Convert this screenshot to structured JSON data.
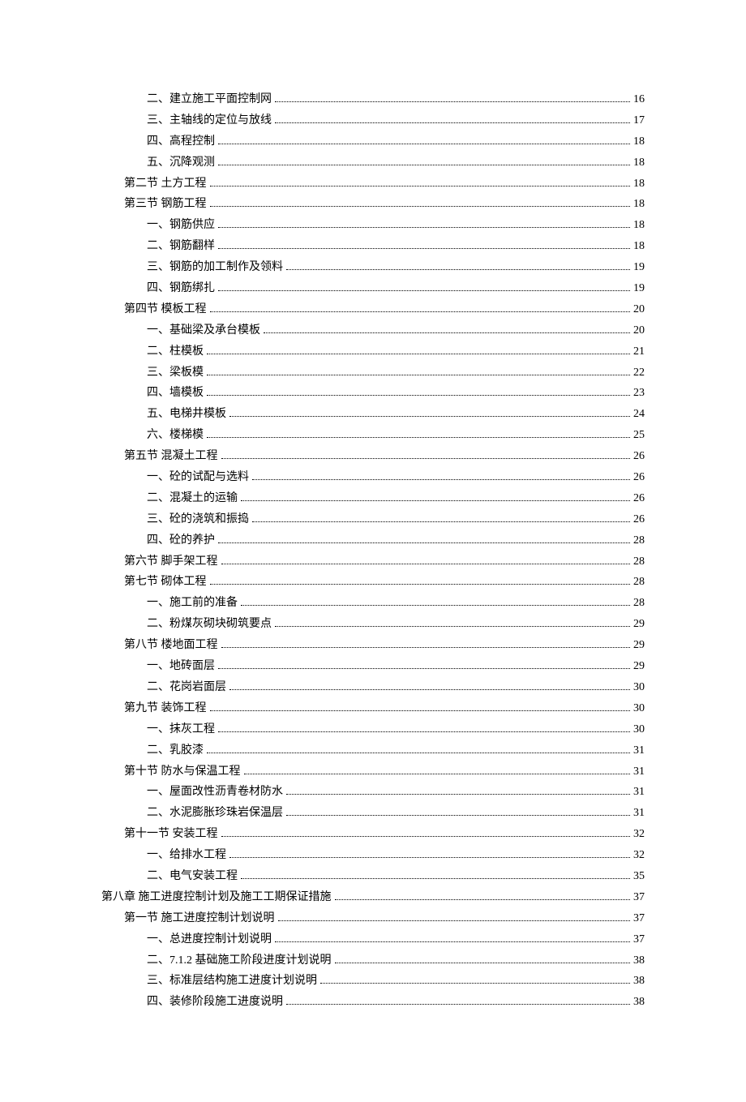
{
  "toc": [
    {
      "level": 2,
      "label": "二、建立施工平面控制网",
      "page": "16"
    },
    {
      "level": 2,
      "label": "三、主轴线的定位与放线",
      "page": "17"
    },
    {
      "level": 2,
      "label": "四、高程控制",
      "page": "18"
    },
    {
      "level": 2,
      "label": "五、沉降观测",
      "page": "18"
    },
    {
      "level": 1,
      "label": "第二节 土方工程",
      "page": "18"
    },
    {
      "level": 1,
      "label": "第三节 钢筋工程",
      "page": "18"
    },
    {
      "level": 2,
      "label": "一、钢筋供应",
      "page": "18"
    },
    {
      "level": 2,
      "label": "二、钢筋翻样",
      "page": "18"
    },
    {
      "level": 2,
      "label": "三、钢筋的加工制作及领料",
      "page": "19"
    },
    {
      "level": 2,
      "label": "四、钢筋绑扎",
      "page": "19"
    },
    {
      "level": 1,
      "label": "第四节 模板工程",
      "page": "20"
    },
    {
      "level": 2,
      "label": "一、基础梁及承台模板",
      "page": "20"
    },
    {
      "level": 2,
      "label": "二、柱模板",
      "page": "21"
    },
    {
      "level": 2,
      "label": "三、梁板模",
      "page": "22"
    },
    {
      "level": 2,
      "label": "四、墙模板",
      "page": "23"
    },
    {
      "level": 2,
      "label": "五、电梯井模板",
      "page": "24"
    },
    {
      "level": 2,
      "label": "六、楼梯模",
      "page": "25"
    },
    {
      "level": 1,
      "label": "第五节 混凝土工程",
      "page": "26"
    },
    {
      "level": 2,
      "label": "一、砼的试配与选料",
      "page": "26"
    },
    {
      "level": 2,
      "label": "二、混凝土的运输",
      "page": "26"
    },
    {
      "level": 2,
      "label": "三、砼的浇筑和振捣",
      "page": "26"
    },
    {
      "level": 2,
      "label": "四、砼的养护",
      "page": "28"
    },
    {
      "level": 1,
      "label": "第六节 脚手架工程",
      "page": "28"
    },
    {
      "level": 1,
      "label": "第七节 砌体工程",
      "page": "28"
    },
    {
      "level": 2,
      "label": "一、施工前的准备",
      "page": "28"
    },
    {
      "level": 2,
      "label": "二、粉煤灰砌块砌筑要点",
      "page": "29"
    },
    {
      "level": 1,
      "label": "第八节 楼地面工程",
      "page": "29"
    },
    {
      "level": 2,
      "label": "一、地砖面层",
      "page": "29"
    },
    {
      "level": 2,
      "label": "二、花岗岩面层",
      "page": "30"
    },
    {
      "level": 1,
      "label": "第九节 装饰工程",
      "page": "30"
    },
    {
      "level": 2,
      "label": "一、抹灰工程",
      "page": "30"
    },
    {
      "level": 2,
      "label": "二、乳胶漆",
      "page": "31"
    },
    {
      "level": 1,
      "label": "第十节 防水与保温工程",
      "page": "31"
    },
    {
      "level": 2,
      "label": "一、屋面改性沥青卷材防水",
      "page": "31"
    },
    {
      "level": 2,
      "label": "二、水泥膨胀珍珠岩保温层",
      "page": "31"
    },
    {
      "level": 1,
      "label": "第十一节 安装工程",
      "page": "32"
    },
    {
      "level": 2,
      "label": "一、给排水工程",
      "page": "32"
    },
    {
      "level": 2,
      "label": "二、电气安装工程",
      "page": "35"
    },
    {
      "level": 0,
      "label": "第八章 施工进度控制计划及施工工期保证措施",
      "page": "37"
    },
    {
      "level": 1,
      "label": "第一节 施工进度控制计划说明",
      "page": "37"
    },
    {
      "level": 2,
      "label": "一、总进度控制计划说明",
      "page": "37"
    },
    {
      "level": 2,
      "label": "二、7.1.2 基础施工阶段进度计划说明",
      "page": "38"
    },
    {
      "level": 2,
      "label": "三、标准层结构施工进度计划说明",
      "page": "38"
    },
    {
      "level": 2,
      "label": "四、装修阶段施工进度说明",
      "page": "38"
    }
  ]
}
